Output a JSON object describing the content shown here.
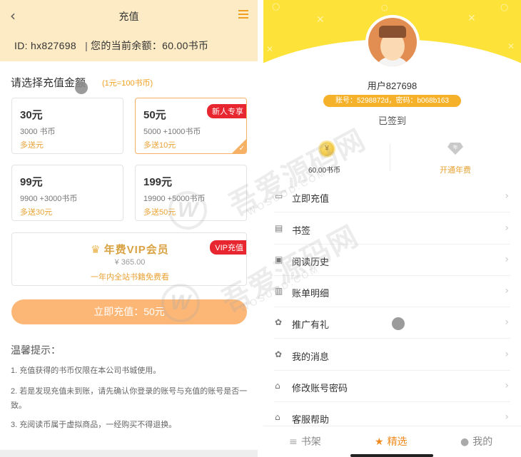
{
  "left": {
    "header": {
      "back_icon": "chevron-left-icon",
      "title": "充值",
      "menu_icon": "hamburger-menu-icon",
      "id_label": "ID:",
      "id_value": "hx827698",
      "separator": "|",
      "balance_text": "您的当前余额：60.00书币"
    },
    "choose_label": "请选择充值金额",
    "rate_label": "(1元=100书币)",
    "options": [
      {
        "amount": "30元",
        "coins": "3000 书币",
        "bonus": "多送元",
        "tag": "",
        "selected": false
      },
      {
        "amount": "50元",
        "coins": "5000 +1000书币",
        "bonus": "多送10元",
        "tag": "新人专享",
        "selected": true
      },
      {
        "amount": "99元",
        "coins": "9900 +3000书币",
        "bonus": "多送30元",
        "tag": "",
        "selected": false
      },
      {
        "amount": "199元",
        "coins": "19900 +5000书币",
        "bonus": "多送50元",
        "tag": "",
        "selected": false
      }
    ],
    "vip": {
      "title": "年费VIP会员",
      "price": "¥ 365.00",
      "desc": "一年内全站书籍免费看",
      "tag": "VIP充值"
    },
    "pay_button": "立即充值：50元",
    "tips": {
      "title": "温馨提示：",
      "items": [
        "1. 充值获得的书币仅限在本公司书城使用。",
        "2. 若是发现充值未到账，请先确认你登录的账号与充值的账号是否一致。",
        "3. 充阅读币属于虚拟商品，一经购买不得退换。"
      ]
    }
  },
  "right": {
    "username": "用户827698",
    "account_info": "账号：5298872d，密码：b068b163",
    "signed_status": "已签到",
    "coins_label": "60.00书币",
    "coin_icon_glyph": "¥",
    "vip_label": "开通年费",
    "menu": [
      {
        "label": "立即充值",
        "icon": "wallet-icon"
      },
      {
        "label": "书签",
        "icon": "bookmark-icon"
      },
      {
        "label": "阅读历史",
        "icon": "history-icon"
      },
      {
        "label": "账单明细",
        "icon": "bill-icon"
      },
      {
        "label": "推广有礼",
        "icon": "share-icon"
      },
      {
        "label": "我的消息",
        "icon": "message-icon"
      },
      {
        "label": "修改账号密码",
        "icon": "password-icon"
      },
      {
        "label": "客服帮助",
        "icon": "help-icon"
      }
    ],
    "tabs": [
      {
        "label": "书架",
        "icon": "bookshelf-icon",
        "active": false
      },
      {
        "label": "精选",
        "icon": "star-icon",
        "active": true
      },
      {
        "label": "我的",
        "icon": "user-icon",
        "active": false
      }
    ]
  },
  "colors": {
    "header_bg": "#fcebc4",
    "accent_orange": "#f0a020",
    "tag_red": "#e8262f",
    "pay_button": "#fcb776",
    "profile_yellow": "#fde23a",
    "active_tab": "#f08a1d"
  }
}
